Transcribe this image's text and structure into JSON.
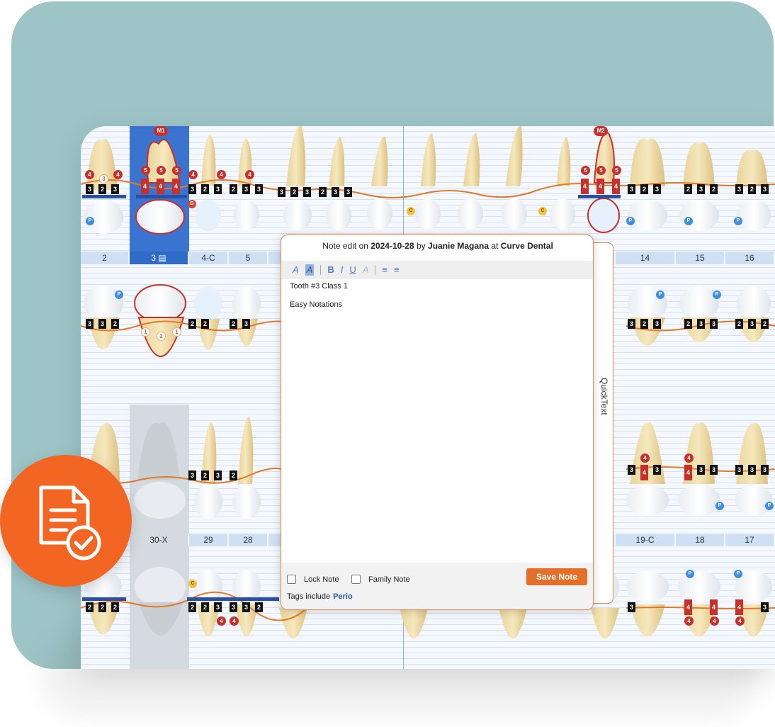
{
  "colors": {
    "teal_background": "#9dc4c6",
    "accent_orange": "#e36f2a",
    "selected_tooth_blue": "#2f6cc9",
    "missing_tooth_grey": "#d4dadf"
  },
  "chart": {
    "upper_tooth_numbers": [
      "2",
      "3",
      "4-C",
      "5",
      "",
      "",
      "",
      "",
      "",
      "",
      "14",
      "15",
      "16"
    ],
    "lower_tooth_numbers": [
      "",
      "30-X",
      "29",
      "28",
      "",
      "",
      "",
      "",
      "",
      "",
      "19-C",
      "18",
      "17"
    ],
    "selected_tooth": "3",
    "missing_tooth": "30-X",
    "marker_labels": [
      "M1",
      "M2"
    ],
    "badge_letters": [
      "P",
      "C",
      "B"
    ]
  },
  "note_dialog": {
    "header_prefix": "Note edit on",
    "date": "2024-10-28",
    "by_label": "by",
    "author": "Juanie Magana",
    "at_label": "at",
    "location": "Curve Dental",
    "toolbar_icons": [
      "font-color-icon",
      "highlight-icon",
      "bold-icon",
      "italic-icon",
      "underline-icon",
      "clear-format-icon",
      "numbered-list-icon",
      "bullet-list-icon"
    ],
    "toolbar_glyphs": {
      "font_color": "A",
      "highlight": "A",
      "bold": "B",
      "italic": "I",
      "underline": "U",
      "clear": "A"
    },
    "content_lines": [
      "Tooth #3 Class 1",
      "Easy Notations"
    ],
    "lock_note_label": "Lock Note",
    "family_note_label": "Family Note",
    "save_label": "Save Note",
    "tags_label": "Tags include",
    "tag_value": "Perio"
  },
  "quicktext": {
    "label": "QuickText"
  }
}
